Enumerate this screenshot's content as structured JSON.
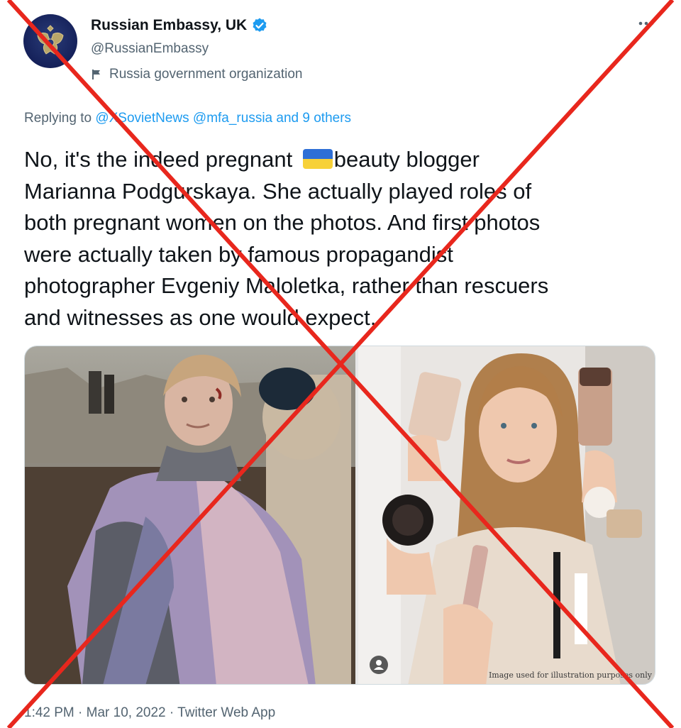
{
  "author": {
    "display_name": "Russian Embassy, UK",
    "handle": "@RussianEmbassy",
    "label": "Russia government organization",
    "avatar_icon": "embassy-coat-of-arms",
    "verified_icon": "verified-badge-icon"
  },
  "reply": {
    "prefix": "Replying to ",
    "mention_1": "@XSovietNews",
    "mention_2": "@mfa_russia",
    "others": "and 9 others"
  },
  "tweet": {
    "lines": [
      {
        "before": "No, it's the indeed pregnant ",
        "after": "beauty blogger"
      },
      "Marianna Podgurskaya. She actually played roles of",
      "both pregnant women on the photos. And first photos",
      "were actually taken by famous propagandist",
      "photographer Evgeniy Maloletka, rather than rescuers",
      "and witnesses as one would expect."
    ],
    "flag_emoji": "ukraine-flag"
  },
  "media": {
    "right_caption": "Image used for illustration purposes only"
  },
  "meta": {
    "time": "1:42 PM",
    "date": "Mar 10, 2022",
    "source": "Twitter Web App",
    "separator": " · "
  },
  "overlay": {
    "cross_color": "#e8271d"
  },
  "colors": {
    "link": "#1d9bf0",
    "secondary_text": "#536471",
    "primary_text": "#0f1419"
  }
}
